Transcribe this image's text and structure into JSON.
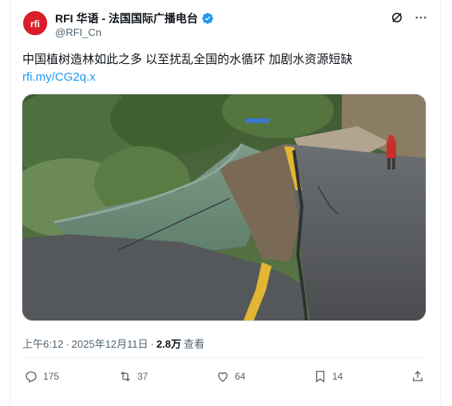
{
  "account": {
    "display_name": "RFI 华语 - 法国国际广播电台",
    "handle": "@RFI_Cn",
    "avatar_text": "rfi"
  },
  "tweet": {
    "text": "中国植树造林如此之多 以至扰乱全国的水循环 加剧水资源短缺",
    "link": "rfi.my/CG2q.x"
  },
  "meta": {
    "time": "上午6:12",
    "sep1": "·",
    "date": "2025年12月11日",
    "sep2": "·",
    "views_count": "2.8万",
    "views_label": "查看"
  },
  "actions": {
    "replies": "175",
    "retweets": "37",
    "likes": "64",
    "bookmarks": "14"
  },
  "colors": {
    "link": "#1d9bf0",
    "verified": "#1d9bf0",
    "brand_red": "#d81e2a",
    "secondary_text": "#536471"
  }
}
